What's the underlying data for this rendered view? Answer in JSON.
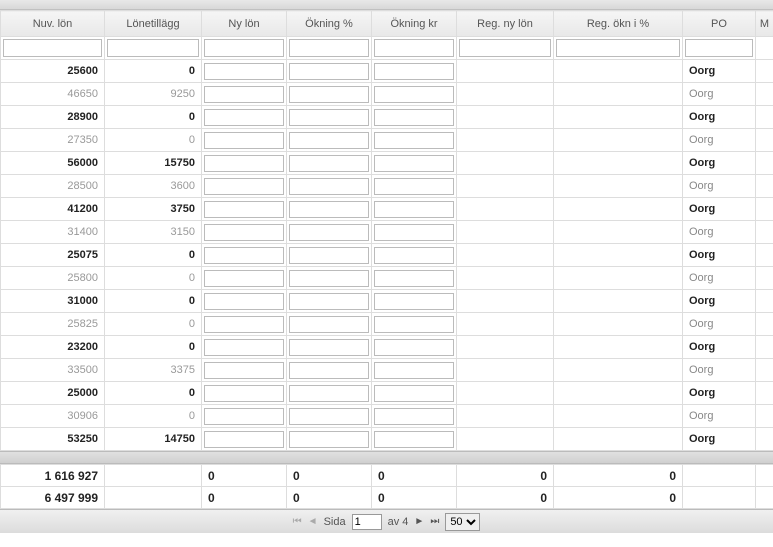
{
  "columns": {
    "nuv_lon": "Nuv. lön",
    "lonetillagg": "Lönetillägg",
    "ny_lon": "Ny lön",
    "okning_pct": "Ökning %",
    "okning_kr": "Ökning kr",
    "reg_ny_lon": "Reg. ny lön",
    "reg_okn_pct": "Reg. ökn i %",
    "po": "PO",
    "m": "M"
  },
  "rows": [
    {
      "nuv": "25600",
      "lone": "0",
      "po": "Oorg",
      "bold": true
    },
    {
      "nuv": "46650",
      "lone": "9250",
      "po": "Oorg",
      "bold": false
    },
    {
      "nuv": "28900",
      "lone": "0",
      "po": "Oorg",
      "bold": true
    },
    {
      "nuv": "27350",
      "lone": "0",
      "po": "Oorg",
      "bold": false
    },
    {
      "nuv": "56000",
      "lone": "15750",
      "po": "Oorg",
      "bold": true
    },
    {
      "nuv": "28500",
      "lone": "3600",
      "po": "Oorg",
      "bold": false
    },
    {
      "nuv": "41200",
      "lone": "3750",
      "po": "Oorg",
      "bold": true
    },
    {
      "nuv": "31400",
      "lone": "3150",
      "po": "Oorg",
      "bold": false
    },
    {
      "nuv": "25075",
      "lone": "0",
      "po": "Oorg",
      "bold": true
    },
    {
      "nuv": "25800",
      "lone": "0",
      "po": "Oorg",
      "bold": false
    },
    {
      "nuv": "31000",
      "lone": "0",
      "po": "Oorg",
      "bold": true
    },
    {
      "nuv": "25825",
      "lone": "0",
      "po": "Oorg",
      "bold": false
    },
    {
      "nuv": "23200",
      "lone": "0",
      "po": "Oorg",
      "bold": true
    },
    {
      "nuv": "33500",
      "lone": "3375",
      "po": "Oorg",
      "bold": false
    },
    {
      "nuv": "25000",
      "lone": "0",
      "po": "Oorg",
      "bold": true
    },
    {
      "nuv": "30906",
      "lone": "0",
      "po": "Oorg",
      "bold": false
    },
    {
      "nuv": "53250",
      "lone": "14750",
      "po": "Oorg",
      "bold": true
    }
  ],
  "totals": [
    {
      "nuv": "1 616 927",
      "ny": "0",
      "opct": "0",
      "okr": "0",
      "reg1": "0",
      "reg2": "0"
    },
    {
      "nuv": "6 497 999",
      "ny": "0",
      "opct": "0",
      "okr": "0",
      "reg1": "0",
      "reg2": "0"
    }
  ],
  "pager": {
    "sida_label": "Sida",
    "page": "1",
    "av_label": "av 4",
    "page_size": "50"
  }
}
